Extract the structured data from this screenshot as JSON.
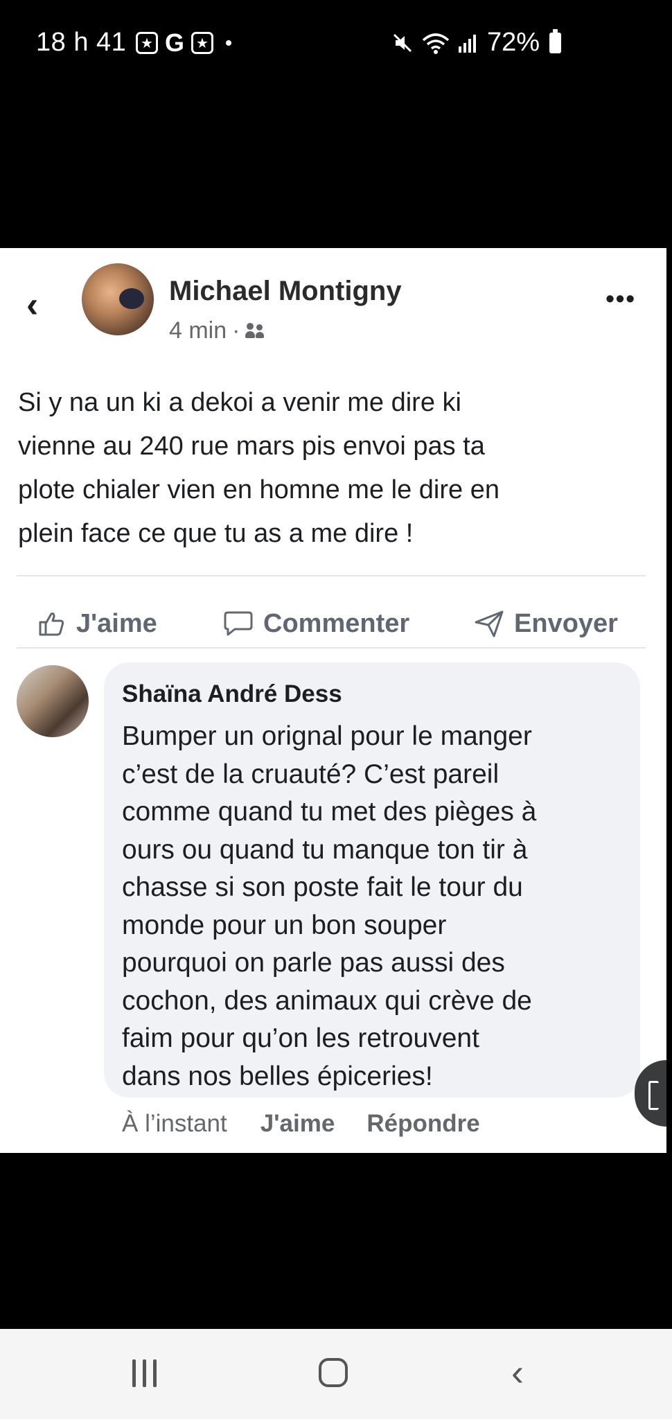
{
  "status_bar": {
    "time": "18 h 41",
    "left_icons": [
      "star-box-icon",
      "G",
      "star-box-icon"
    ],
    "right_icons": [
      "mute-icon",
      "wifi-icon",
      "signal-icon"
    ],
    "battery": "72%"
  },
  "post": {
    "author": "Michael Montigny",
    "time": "4 min",
    "audience_icon": "friends-icon",
    "text": "Si y na un ki a dekoi a venir me dire ki\nvienne au 240 rue mars pis envoi pas ta\nplote chialer vien en homne me le dire en\nplein face ce que tu as a me dire !",
    "actions": {
      "like": "J'aime",
      "comment": "Commenter",
      "send": "Envoyer"
    }
  },
  "comment": {
    "author": "Shaïna André Dess",
    "text": "Bumper un orignal pour le manger\nc’est de la cruauté? C’est pareil\ncomme quand tu met des pièges à\nours ou quand tu manque ton tir à\nchasse si son poste fait le tour du\nmonde pour un bon souper\npourquoi on parle pas aussi des\ncochon, des animaux qui crève de\nfaim pour qu’on les retrouvent\ndans nos belles épiceries!",
    "time": "À l’instant",
    "like": "J'aime",
    "reply": "Répondre"
  },
  "nav_bar": {
    "icons": [
      "recents-icon",
      "home-icon",
      "back-icon"
    ]
  }
}
